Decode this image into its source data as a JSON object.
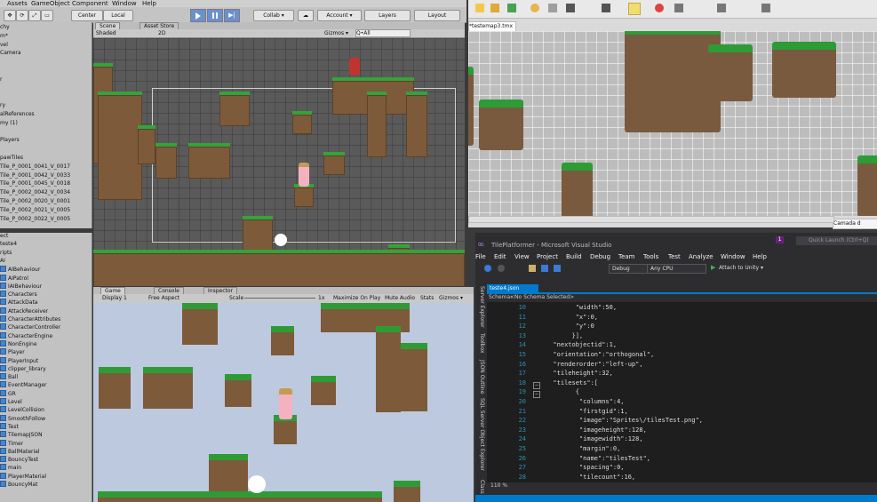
{
  "unity": {
    "menu": [
      "Assets",
      "GameObject",
      "Component",
      "Window",
      "Help"
    ],
    "toolbar": {
      "center": "Center",
      "local": "Local",
      "collab": "Collab ▾",
      "account": "Account ▾",
      "layers": "Layers",
      "layout": "Layout"
    },
    "scene_tab": "Scene",
    "asset_store_tab": "Asset Store",
    "shading": "Shaded",
    "mode_2d": "2D",
    "gizmos": "Gizmos ▾",
    "search_all": "Q•All",
    "game_tab": "Game",
    "console_tab": "Console",
    "inspector_tab": "Inspector",
    "display": "Display 1",
    "aspect": "Free Aspect",
    "scale_label": "Scale",
    "scale_value": "1x",
    "maximize": "Maximize On Play",
    "mute": "Mute Audio",
    "stats": "Stats",
    "game_gizmos": "Gizmos ▾",
    "hierarchy": [
      "chy",
      "m*",
      "vel",
      "Camera",
      "",
      "",
      "r",
      "",
      "",
      "ry",
      "alReferences",
      "my (1)",
      "",
      "Players",
      "",
      "pawTiles",
      "Tile_P_0001_0041_V_0017",
      "Tile_P_0001_0042_V_0033",
      "Tile_P_0001_0045_V_0018",
      "Tile_P_0002_0042_V_0034",
      "Tile_P_0002_0020_V_0001",
      "Tile_P_0002_0021_V_0005",
      "Tile_P_0002_0022_V_0005"
    ],
    "project": [
      "ect",
      "teste4",
      "ripts",
      "AI",
      "AIBehaviour",
      "AIPatrol",
      "IAIBehaviour",
      "Characters",
      "AttackData",
      "AttackReceiver",
      "CharacterAttributes",
      "CharacterController",
      "CharacterEngine",
      "NonEngine",
      "Player",
      "PlayerInput",
      "clipper_library",
      "Ball",
      "EventManager",
      "GR",
      "Level",
      "LevelCollision",
      "SmoothFollow",
      "Test",
      "TilemapJSON",
      "Timer",
      "BallMaterial",
      "BouncyTest",
      "main",
      "PlayerMaterial",
      "BouncyMat"
    ]
  },
  "tiled": {
    "tab": "*testemap3.tmx",
    "camada": "Camada d"
  },
  "vs": {
    "title": "TilePlatformer - Microsoft Visual Studio",
    "quick_launch": "Quick Launch (Ctrl+Q)",
    "notifications": "1",
    "menu": [
      "File",
      "Edit",
      "View",
      "Project",
      "Build",
      "Debug",
      "Team",
      "Tools",
      "Test",
      "Analyze",
      "Window",
      "Help"
    ],
    "config": "Debug",
    "platform": "Any CPU",
    "attach": "Attach to Unity ▾",
    "file_tab": "teste4.json",
    "schema_label": "Schema:",
    "schema_value": "<No Schema Selected>",
    "side_tabs": [
      "Server Explorer",
      "Toolbox",
      "JSON Outline",
      "SQL Server Object Explorer",
      "Class"
    ],
    "zoom": "110 %",
    "lines": [
      {
        "n": "10",
        "t": "        \"width\":50,"
      },
      {
        "n": "11",
        "t": "        \"x\":0,"
      },
      {
        "n": "12",
        "t": "        \"y\":0"
      },
      {
        "n": "13",
        "t": "       }],"
      },
      {
        "n": "14",
        "t": "  \"nextobjectid\":1,"
      },
      {
        "n": "15",
        "t": "  \"orientation\":\"orthogonal\","
      },
      {
        "n": "16",
        "t": "  \"renderorder\":\"left-up\","
      },
      {
        "n": "17",
        "t": "  \"tileheight\":32,"
      },
      {
        "n": "18",
        "t": "  \"tilesets\":["
      },
      {
        "n": "19",
        "t": "        {"
      },
      {
        "n": "20",
        "t": "         \"columns\":4,"
      },
      {
        "n": "21",
        "t": "         \"firstgid\":1,"
      },
      {
        "n": "22",
        "t": "         \"image\":\"Sprites\\/tilesTest.png\","
      },
      {
        "n": "23",
        "t": "         \"imageheight\":128,"
      },
      {
        "n": "24",
        "t": "         \"imagewidth\":128,"
      },
      {
        "n": "25",
        "t": "         \"margin\":0,"
      },
      {
        "n": "26",
        "t": "         \"name\":\"tilesTest\","
      },
      {
        "n": "27",
        "t": "         \"spacing\":0,"
      },
      {
        "n": "28",
        "t": "         \"tilecount\":16,"
      }
    ]
  }
}
